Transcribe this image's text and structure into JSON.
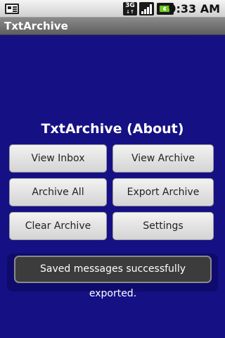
{
  "status_bar": {
    "time": "9:33 AM",
    "network_label": "3G",
    "network_arrows": "↓↑",
    "icons": [
      "notification-icon",
      "3g-icon",
      "signal-icon",
      "battery-icon"
    ]
  },
  "app": {
    "title": "TxtArchive"
  },
  "main": {
    "heading": "TxtArchive (About)",
    "buttons": {
      "view_inbox": "View Inbox",
      "view_archive": "View Archive",
      "archive_all": "Archive All",
      "export_archive": "Export Archive",
      "clear_archive": "Clear Archive",
      "settings": "Settings"
    }
  },
  "toast": {
    "message": "Saved messages successfully exported."
  },
  "colors": {
    "background": "#151184",
    "title_bar": "#6f6f6f",
    "button": "#e6e6e6",
    "toast": "#3c3c3c"
  }
}
